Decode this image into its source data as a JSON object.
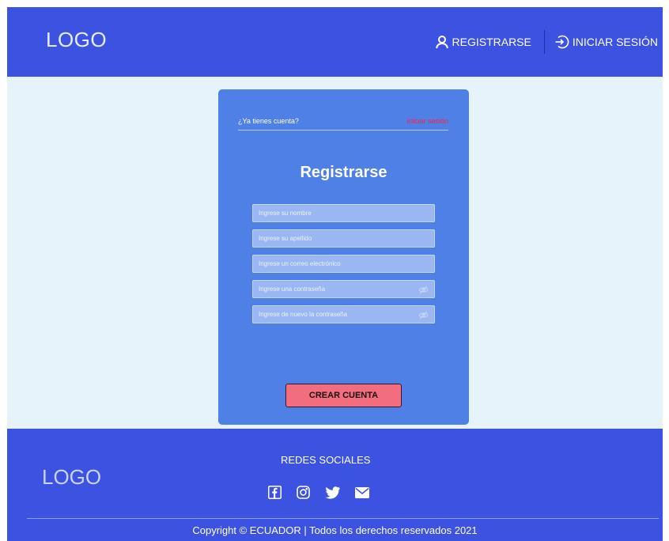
{
  "header": {
    "logo": "LOGO",
    "nav": {
      "register": "REGISTRARSE",
      "login": "INICIAR SESIÓN"
    }
  },
  "card": {
    "have_account": "¿Ya tienes cuenta?",
    "login_link": "Iniciar sesión",
    "title": "Registrarse",
    "fields": {
      "first_name": {
        "placeholder": "Ingrese su nombre",
        "value": ""
      },
      "last_name": {
        "placeholder": "Ingrese su apellido",
        "value": ""
      },
      "email": {
        "placeholder": "Ingrese un correo electrónico",
        "value": ""
      },
      "password": {
        "placeholder": "Ingrese una contraseña",
        "value": ""
      },
      "password_confirm": {
        "placeholder": "Ingrese de nuevo la contraseña",
        "value": ""
      }
    },
    "submit_label": "CREAR CUENTA"
  },
  "footer": {
    "logo": "LOGO",
    "social_title": "REDES SOCIALES",
    "social_icons": [
      "facebook-icon",
      "instagram-icon",
      "twitter-icon",
      "mail-icon"
    ],
    "copyright": "Copyright © ECUADOR  |  Todos los derechos reservados 2021"
  },
  "colors": {
    "header_bg": "#3c53e2",
    "page_bg": "#e6f3fb",
    "card_bg": "#4e80e6",
    "field_bg": "#9ab6f3",
    "button_bg": "#f26d7d",
    "link_red": "#ff1f3d"
  }
}
